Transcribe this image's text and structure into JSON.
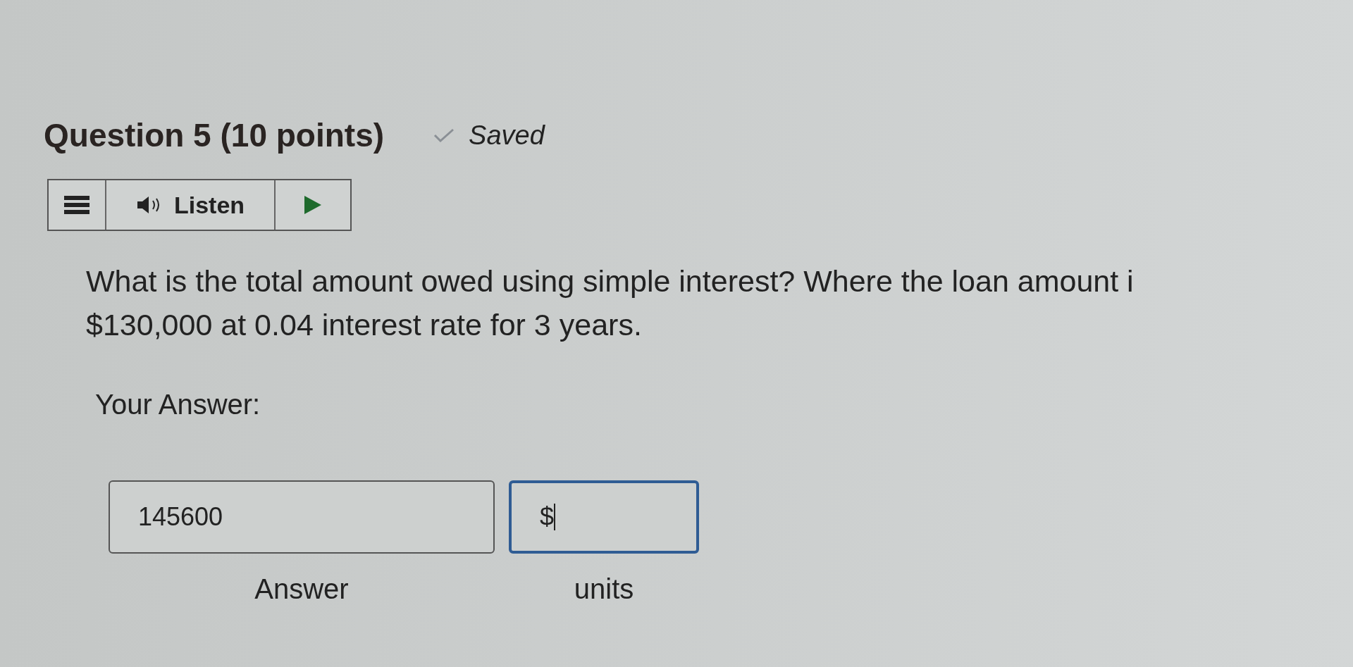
{
  "question": {
    "title": "Question 5 (10 points)",
    "status": "Saved",
    "saved": true
  },
  "listen_bar": {
    "label": "Listen"
  },
  "prompt": {
    "lines": [
      "What is the total amount owed using simple interest? Where the loan amount i",
      "$130,000 at 0.04 interest rate for 3 years."
    ]
  },
  "answer_heading": "Your Answer:",
  "fields": [
    {
      "value": "145600",
      "label": "Answer",
      "focused": false
    },
    {
      "value": "$",
      "label": "units",
      "focused": true
    }
  ]
}
